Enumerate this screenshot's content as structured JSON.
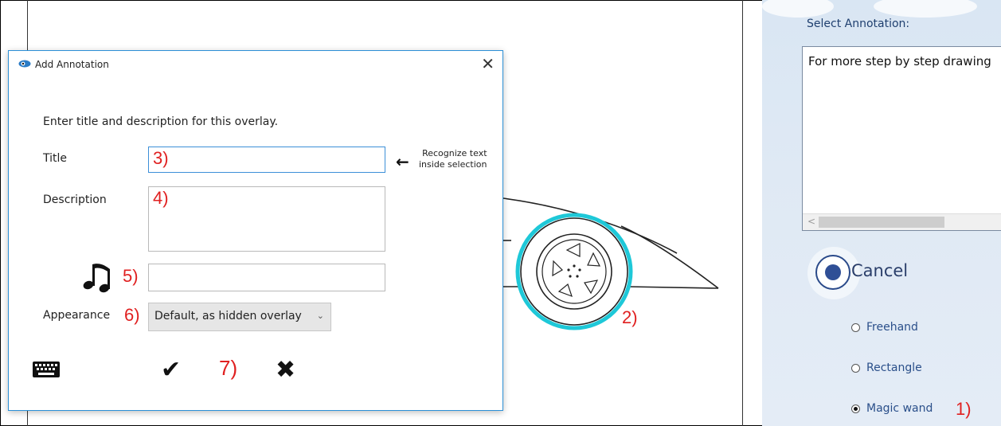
{
  "dialog": {
    "title": "Add Annotation",
    "instruction": "Enter title and description for this overlay.",
    "title_label": "Title",
    "description_label": "Description",
    "appearance_label": "Appearance",
    "appearance_value": "Default, as hidden overlay",
    "recognize_hint_line1": "Recognize text",
    "recognize_hint_line2": "inside selection",
    "close_icon": "close-icon",
    "music_icon": "music-note-icon",
    "keyboard_icon": "keyboard-icon",
    "ok_icon": "checkmark-icon",
    "cancel_icon": "x-icon"
  },
  "callouts": {
    "n1": "1)",
    "n2": "2)",
    "n3": "3)",
    "n4": "4)",
    "n5": "5)",
    "n6": "6)",
    "n7": "7)"
  },
  "right_panel": {
    "select_label": "Select Annotation:",
    "annotation_text": "For more step by step drawing",
    "cancel_label": "Cancel",
    "options": [
      "Freehand",
      "Rectangle",
      "Magic wand"
    ],
    "selected_option": "Magic wand"
  },
  "colors": {
    "accent": "#2b8fd6",
    "callout_red": "#e02020",
    "wheel_cyan": "#1ec8d8",
    "radio_label": "#2a4f8a"
  }
}
